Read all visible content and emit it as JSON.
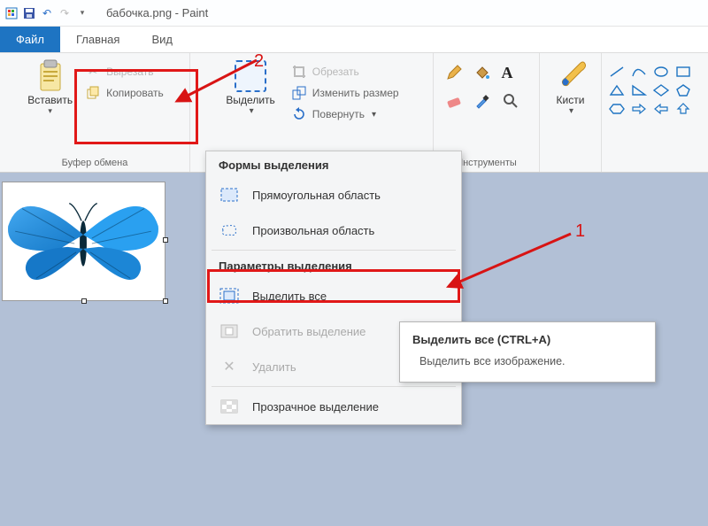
{
  "title": "бабочка.png - Paint",
  "tabs": {
    "file": "Файл",
    "home": "Главная",
    "view": "Вид"
  },
  "groups": {
    "clipboard": {
      "label": "Буфер обмена",
      "paste": "Вставить",
      "cut": "Вырезать",
      "copy": "Копировать"
    },
    "image": {
      "select": "Выделить",
      "crop": "Обрезать",
      "resize": "Изменить размер",
      "rotate": "Повернуть"
    },
    "tools": {
      "label": "Инструменты"
    },
    "brushes": {
      "label": "Кисти"
    }
  },
  "dropdown": {
    "section1": "Формы выделения",
    "rect": "Прямоугольная область",
    "free": "Произвольная область",
    "section2": "Параметры выделения",
    "selectAll": "Выделить все",
    "invert": "Обратить выделение",
    "delete": "Удалить",
    "transparent": "Прозрачное выделение"
  },
  "tooltip": {
    "title": "Выделить все (CTRL+A)",
    "body": "Выделить все изображение."
  },
  "anno": {
    "n1": "1",
    "n2": "2"
  }
}
